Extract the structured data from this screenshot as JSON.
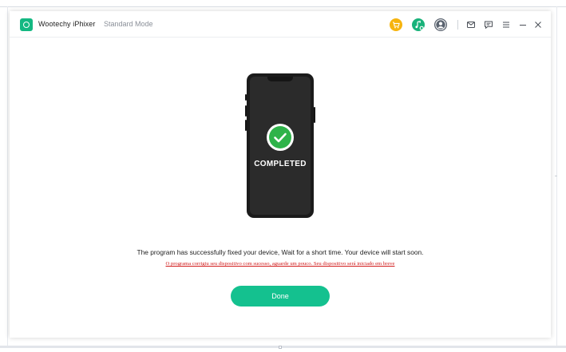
{
  "window": {
    "app_name": "Wootechy iPhixer",
    "mode_label": "Standard Mode"
  },
  "toolbar": {
    "icons": [
      "cart-icon",
      "music-key-icon",
      "user-account-icon",
      "mail-icon",
      "feedback-icon",
      "menu-icon",
      "minimize-icon",
      "close-icon"
    ]
  },
  "main": {
    "status_text": "COMPLETED",
    "message": "The program has successfully fixed your device, Wait for a short time. Your device will start soon.",
    "translation": "O programa corrigiu seu dispositivo com sucesso, aguarde um pouco. Seu dispositivo será iniciado em breve",
    "done_label": "Done"
  },
  "colors": {
    "accent": "#14c18f",
    "logo": "#14b882",
    "success": "#2fb34a",
    "cart": "#f6b40e",
    "warning_text": "#d11a1a"
  }
}
